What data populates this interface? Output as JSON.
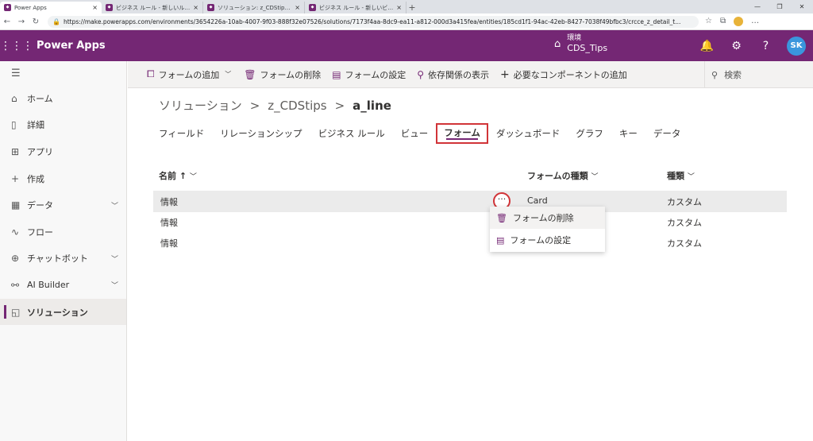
{
  "browser": {
    "tabs": [
      {
        "title": "Power Apps"
      },
      {
        "title": "ビジネス ルール - 新しいルール - Micr"
      },
      {
        "title": "ソリューション: z_CDStips - Micros"
      },
      {
        "title": "ビジネス ルール - 新しいビジネス ル"
      }
    ],
    "url": "https://make.powerapps.com/environments/3654226a-10ab-4007-9f03-888f32e07526/solutions/7173f4aa-8dc9-ea11-a812-000d3a415fea/entities/185cd1f1-94ac-42eb-8427-7038f49bfbc3/crcce_z_detail_t..."
  },
  "header": {
    "app_name": "Power Apps",
    "env_label": "環境",
    "env_name": "CDS_Tips",
    "avatar_initials": "SK",
    "accent": "#742774"
  },
  "sidebar": {
    "items": [
      {
        "label": "ホーム"
      },
      {
        "label": "詳細"
      },
      {
        "label": "アプリ"
      },
      {
        "label": "作成"
      },
      {
        "label": "データ"
      },
      {
        "label": "フロー"
      },
      {
        "label": "チャットボット"
      },
      {
        "label": "AI Builder"
      },
      {
        "label": "ソリューション"
      }
    ]
  },
  "commandbar": {
    "add_form": "フォームの追加",
    "delete_form": "フォームの削除",
    "form_settings": "フォームの設定",
    "show_dependencies": "依存関係の表示",
    "add_required": "必要なコンポーネントの追加",
    "search": "検索"
  },
  "breadcrumb": {
    "root": "ソリューション",
    "solution": "z_CDStips",
    "entity": "a_line"
  },
  "tabs": [
    {
      "label": "フィールド"
    },
    {
      "label": "リレーションシップ"
    },
    {
      "label": "ビジネス ルール"
    },
    {
      "label": "ビュー"
    },
    {
      "label": "フォーム"
    },
    {
      "label": "ダッシュボード"
    },
    {
      "label": "グラフ"
    },
    {
      "label": "キー"
    },
    {
      "label": "データ"
    }
  ],
  "table": {
    "columns": {
      "name": "名前 ↑",
      "form_type": "フォームの種類",
      "type": "種類"
    },
    "rows": [
      {
        "name": "情報",
        "form_type": "Card",
        "type": "カスタム"
      },
      {
        "name": "情報",
        "form_type": "",
        "type": "カスタム"
      },
      {
        "name": "情報",
        "form_type": "",
        "type": "カスタム"
      }
    ],
    "more_glyph": "···"
  },
  "context_menu": {
    "items": [
      {
        "label": "フォームの削除"
      },
      {
        "label": "フォームの設定"
      }
    ]
  }
}
